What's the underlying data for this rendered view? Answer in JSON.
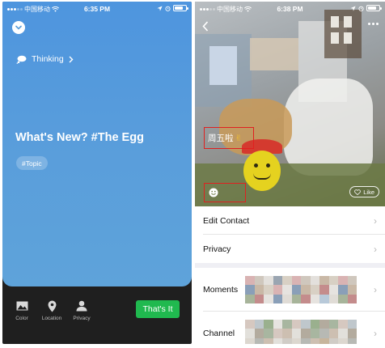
{
  "left_screen": {
    "status": {
      "carrier": "中国移动",
      "time": "6:35 PM",
      "battery_level": 0.8
    },
    "thinking_label": "Thinking",
    "headline": "What's New? #The Egg",
    "topic_chip": "#Topic",
    "tools": [
      {
        "label": "Color",
        "icon": "image-icon"
      },
      {
        "label": "Location",
        "icon": "location-pin-icon"
      },
      {
        "label": "Privacy",
        "icon": "person-icon"
      }
    ],
    "submit_label": "That's It",
    "colors": {
      "card": "#5a9edb",
      "dark": "#1f1f1f",
      "accent": "#20b94f"
    }
  },
  "right_screen": {
    "status": {
      "carrier": "中国移动",
      "time": "6:38 PM",
      "battery_level": 0.8
    },
    "signature": "周五啦",
    "signature_emoji": "✌",
    "like_label": "Like",
    "menu": {
      "edit_contact": "Edit Contact",
      "privacy": "Privacy",
      "moments": "Moments",
      "channel": "Channel"
    },
    "colors": {
      "highlight_box": "#e02020",
      "chevron": "#b9b9b9"
    }
  }
}
